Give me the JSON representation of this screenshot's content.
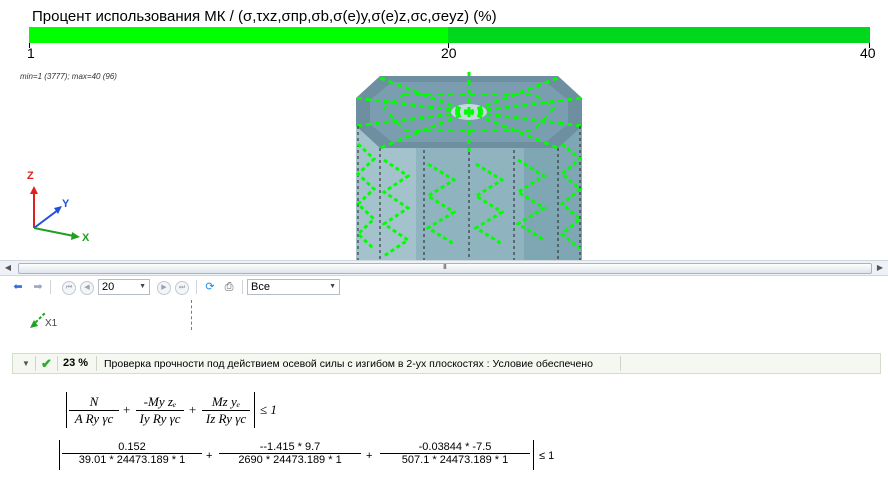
{
  "legend": {
    "title": "Процент использования МК / (σ,τxz,σпр,σb,σ(e)y,σ(e)z,σc,σeyz) (%)",
    "ticks": [
      "1",
      "20",
      "40"
    ],
    "colors": {
      "low": "#00ff00",
      "high": "#00d81e"
    }
  },
  "viewport": {
    "minmax": "min=1 (3777); max=40 (96)",
    "axes": {
      "z": "Z",
      "y": "Y",
      "x": "X"
    },
    "local_axis": "X1"
  },
  "scrollbar": {
    "grip": "III"
  },
  "toolbar": {
    "back_icon": "arrow-left-icon",
    "forward_icon": "arrow-right-icon",
    "page_value": "20",
    "filter_value": "Все"
  },
  "check": {
    "percent": "23 %",
    "description": "Проверка прочности под действием осевой силы с изгибом в 2-ух плоскостях : Условие обеспечено"
  },
  "formula": {
    "sym": {
      "n_num": "N",
      "n_den": "A Ry γc",
      "my_num": "-My zₑ",
      "my_den": "Iy Ry γc",
      "mz_num": "Mz yₑ",
      "mz_den": "Iz Ry γc",
      "plus": "+",
      "le": "≤ 1"
    },
    "num": {
      "t1_num": "0.152",
      "t1_den": "39.01 * 24473.189 * 1",
      "t2_num": "--1.415 * 9.7",
      "t2_den": "2690 * 24473.189 * 1",
      "t3_num": "-0.03844 * -7.5",
      "t3_den": "507.1 * 24473.189 * 1",
      "plus": "+",
      "le": "≤ 1"
    }
  }
}
